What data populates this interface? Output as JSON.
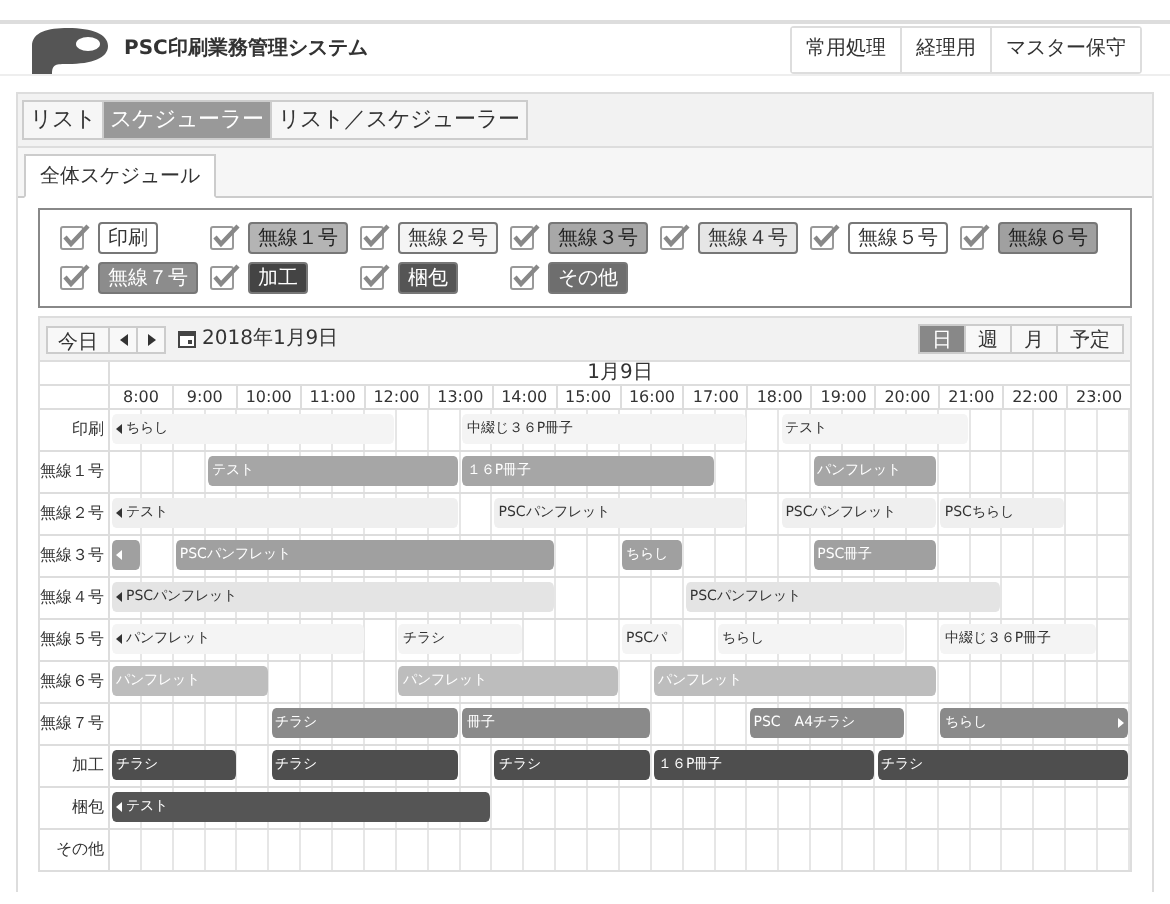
{
  "header": {
    "title": "PSC印刷業務管理システム",
    "menu": [
      "常用処理",
      "経理用",
      "マスター保守"
    ]
  },
  "view_tabs": [
    {
      "label": "リスト",
      "selected": false
    },
    {
      "label": "スケジューラー",
      "selected": true
    },
    {
      "label": "リスト／スケジューラー",
      "selected": false
    }
  ],
  "sub_tabs": [
    {
      "label": "全体スケジュール",
      "selected": true
    }
  ],
  "filters": [
    {
      "label": "印刷",
      "checked": true,
      "color": "#ffffff"
    },
    {
      "label": "無線１号",
      "checked": true,
      "color": "#b4b4b4"
    },
    {
      "label": "無線２号",
      "checked": true,
      "color": "#f4f4f4"
    },
    {
      "label": "無線３号",
      "checked": true,
      "color": "#a8a8a8"
    },
    {
      "label": "無線４号",
      "checked": true,
      "color": "#e6e6e6"
    },
    {
      "label": "無線５号",
      "checked": true,
      "color": "#ffffff"
    },
    {
      "label": "無線６号",
      "checked": true,
      "color": "#a0a0a0"
    },
    {
      "label": "無線７号",
      "checked": true,
      "color": "#8c8c8c"
    },
    {
      "label": "加工",
      "checked": true,
      "color": "#444444"
    },
    {
      "label": "梱包",
      "checked": true,
      "color": "#555555"
    },
    {
      "label": "その他",
      "checked": true,
      "color": "#6e6e6e"
    }
  ],
  "toolbar": {
    "today": "今日",
    "date": "2018年1月9日",
    "views": [
      {
        "label": "日",
        "selected": true
      },
      {
        "label": "週",
        "selected": false
      },
      {
        "label": "月",
        "selected": false
      },
      {
        "label": "予定",
        "selected": false
      }
    ]
  },
  "schedule": {
    "day": "1月9日",
    "hours": [
      "8:00",
      "9:00",
      "10:00",
      "11:00",
      "12:00",
      "13:00",
      "14:00",
      "15:00",
      "16:00",
      "17:00",
      "18:00",
      "19:00",
      "20:00",
      "21:00",
      "22:00",
      "23:00"
    ],
    "rows": [
      {
        "label": "印刷",
        "cells": [
          {
            "kind": "start",
            "label": "ちらし",
            "color": "#f4f4f4",
            "continues_before": true,
            "continues_after": false
          },
          {
            "kind": "cont"
          },
          {
            "kind": "cont"
          },
          {
            "kind": "cont"
          },
          {
            "kind": "cont"
          },
          {
            "kind": "cont"
          },
          {
            "kind": "cont"
          },
          {
            "kind": "cont"
          },
          {
            "kind": "cont"
          },
          {
            "kind": "free"
          },
          {
            "kind": "free"
          },
          {
            "kind": "start",
            "label": "中綴じ３６P冊子",
            "color": "#f4f4f4",
            "continues_before": false,
            "continues_after": false
          },
          {
            "kind": "cont"
          },
          {
            "kind": "cont"
          },
          {
            "kind": "cont"
          },
          {
            "kind": "cont"
          },
          {
            "kind": "cont"
          },
          {
            "kind": "cont"
          },
          {
            "kind": "cont"
          },
          {
            "kind": "cont"
          },
          {
            "kind": "free"
          },
          {
            "kind": "start",
            "label": "テスト",
            "color": "#f4f4f4",
            "continues_before": false,
            "continues_after": false
          },
          {
            "kind": "cont"
          },
          {
            "kind": "cont"
          },
          {
            "kind": "cont"
          },
          {
            "kind": "cont"
          },
          {
            "kind": "cont"
          }
        ]
      },
      {
        "label": "無線１号",
        "cells": [
          {
            "kind": "free"
          },
          {
            "kind": "free"
          },
          {
            "kind": "free"
          },
          {
            "kind": "start",
            "label": "テスト",
            "color": "#a6a6a6",
            "continues_before": false,
            "continues_after": false
          },
          {
            "kind": "cont"
          },
          {
            "kind": "cont"
          },
          {
            "kind": "cont"
          },
          {
            "kind": "cont"
          },
          {
            "kind": "cont"
          },
          {
            "kind": "cont"
          },
          {
            "kind": "cont"
          },
          {
            "kind": "start",
            "label": "１６P冊子",
            "color": "#a6a6a6",
            "continues_before": false,
            "continues_after": false
          },
          {
            "kind": "cont"
          },
          {
            "kind": "cont"
          },
          {
            "kind": "cont"
          },
          {
            "kind": "cont"
          },
          {
            "kind": "cont"
          },
          {
            "kind": "cont"
          },
          {
            "kind": "cont"
          },
          {
            "kind": "free"
          },
          {
            "kind": "free"
          },
          {
            "kind": "free"
          },
          {
            "kind": "start",
            "label": "パンフレット",
            "color": "#a6a6a6",
            "continues_before": false,
            "continues_after": false
          },
          {
            "kind": "cont"
          },
          {
            "kind": "cont"
          },
          {
            "kind": "cont"
          }
        ]
      },
      {
        "label": "無線２号",
        "cells": [
          {
            "kind": "start",
            "label": "テスト",
            "color": "#efefef",
            "continues_before": true,
            "continues_after": false
          },
          {
            "kind": "cont"
          },
          {
            "kind": "cont"
          },
          {
            "kind": "cont"
          },
          {
            "kind": "cont"
          },
          {
            "kind": "cont"
          },
          {
            "kind": "cont"
          },
          {
            "kind": "cont"
          },
          {
            "kind": "cont"
          },
          {
            "kind": "cont"
          },
          {
            "kind": "cont"
          },
          {
            "kind": "free"
          },
          {
            "kind": "start",
            "label": "PSCパンフレット",
            "color": "#efefef",
            "continues_before": false,
            "continues_after": false
          },
          {
            "kind": "cont"
          },
          {
            "kind": "cont"
          },
          {
            "kind": "cont"
          },
          {
            "kind": "cont"
          },
          {
            "kind": "cont"
          },
          {
            "kind": "cont"
          },
          {
            "kind": "cont"
          },
          {
            "kind": "free"
          },
          {
            "kind": "start",
            "label": "PSCパンフレット",
            "color": "#efefef",
            "continues_before": false,
            "continues_after": false
          },
          {
            "kind": "cont"
          },
          {
            "kind": "cont"
          },
          {
            "kind": "cont"
          },
          {
            "kind": "cont"
          },
          {
            "kind": "start",
            "label": "PSCちらし",
            "color": "#efefef",
            "continues_before": false,
            "continues_after": false
          },
          {
            "kind": "cont"
          },
          {
            "kind": "cont"
          },
          {
            "kind": "cont"
          }
        ]
      },
      {
        "label": "無線３号",
        "cells": [
          {
            "kind": "start",
            "color": "#a0a0a0",
            "continues_before": true,
            "continues_after": false
          },
          {
            "kind": "free"
          },
          {
            "kind": "start",
            "label": "PSCパンフレット",
            "color": "#a0a0a0",
            "continues_before": false,
            "continues_after": false
          },
          {
            "kind": "cont"
          },
          {
            "kind": "cont"
          },
          {
            "kind": "cont"
          },
          {
            "kind": "cont"
          },
          {
            "kind": "cont"
          },
          {
            "kind": "cont"
          },
          {
            "kind": "cont"
          },
          {
            "kind": "cont"
          },
          {
            "kind": "cont"
          },
          {
            "kind": "cont"
          },
          {
            "kind": "cont"
          },
          {
            "kind": "free"
          },
          {
            "kind": "free"
          },
          {
            "kind": "start",
            "label": "ちらし",
            "color": "#a0a0a0",
            "continues_before": false,
            "continues_after": false
          },
          {
            "kind": "cont"
          },
          {
            "kind": "free"
          },
          {
            "kind": "free"
          },
          {
            "kind": "free"
          },
          {
            "kind": "free"
          },
          {
            "kind": "start",
            "label": "PSC冊子",
            "color": "#a0a0a0",
            "continues_before": false,
            "continues_after": false
          },
          {
            "kind": "cont"
          },
          {
            "kind": "cont"
          },
          {
            "kind": "cont"
          }
        ]
      },
      {
        "label": "無線４号",
        "cells": [
          {
            "kind": "start",
            "label": "PSCパンフレット",
            "color": "#e4e4e4",
            "continues_before": true,
            "continues_after": false
          },
          {
            "kind": "cont"
          },
          {
            "kind": "cont"
          },
          {
            "kind": "cont"
          },
          {
            "kind": "cont"
          },
          {
            "kind": "cont"
          },
          {
            "kind": "cont"
          },
          {
            "kind": "cont"
          },
          {
            "kind": "cont"
          },
          {
            "kind": "cont"
          },
          {
            "kind": "cont"
          },
          {
            "kind": "cont"
          },
          {
            "kind": "cont"
          },
          {
            "kind": "cont"
          },
          {
            "kind": "free"
          },
          {
            "kind": "free"
          },
          {
            "kind": "free"
          },
          {
            "kind": "free"
          },
          {
            "kind": "start",
            "label": "PSCパンフレット",
            "color": "#e4e4e4",
            "continues_before": false,
            "continues_after": false
          },
          {
            "kind": "cont"
          },
          {
            "kind": "cont"
          },
          {
            "kind": "cont"
          },
          {
            "kind": "cont"
          },
          {
            "kind": "cont"
          },
          {
            "kind": "cont"
          },
          {
            "kind": "cont"
          },
          {
            "kind": "cont"
          },
          {
            "kind": "cont"
          }
        ]
      },
      {
        "label": "無線５号",
        "cells": [
          {
            "kind": "start",
            "label": "パンフレット",
            "color": "#f4f4f4",
            "continues_before": true,
            "continues_after": false
          },
          {
            "kind": "cont"
          },
          {
            "kind": "cont"
          },
          {
            "kind": "cont"
          },
          {
            "kind": "cont"
          },
          {
            "kind": "cont"
          },
          {
            "kind": "cont"
          },
          {
            "kind": "cont"
          },
          {
            "kind": "free"
          },
          {
            "kind": "start",
            "label": "チラシ",
            "color": "#f4f4f4",
            "continues_before": false,
            "continues_after": false
          },
          {
            "kind": "cont"
          },
          {
            "kind": "cont"
          },
          {
            "kind": "cont"
          },
          {
            "kind": "free"
          },
          {
            "kind": "free"
          },
          {
            "kind": "free"
          },
          {
            "kind": "start",
            "label": "PSCパ",
            "color": "#f4f4f4",
            "continues_before": false,
            "continues_after": false
          },
          {
            "kind": "cont"
          },
          {
            "kind": "free"
          },
          {
            "kind": "start",
            "label": "ちらし",
            "color": "#f4f4f4",
            "continues_before": false,
            "continues_after": false
          },
          {
            "kind": "cont"
          },
          {
            "kind": "cont"
          },
          {
            "kind": "cont"
          },
          {
            "kind": "cont"
          },
          {
            "kind": "cont"
          },
          {
            "kind": "free"
          },
          {
            "kind": "start",
            "label": "中綴じ３６P冊子",
            "color": "#f4f4f4",
            "continues_before": false,
            "continues_after": false
          },
          {
            "kind": "cont"
          },
          {
            "kind": "cont"
          },
          {
            "kind": "cont"
          },
          {
            "kind": "cont"
          }
        ]
      },
      {
        "label": "無線６号",
        "cells": [
          {
            "kind": "start",
            "label": "パンフレット",
            "color": "#bdbdbd",
            "continues_before": false,
            "continues_after": false
          },
          {
            "kind": "cont"
          },
          {
            "kind": "cont"
          },
          {
            "kind": "cont"
          },
          {
            "kind": "cont"
          },
          {
            "kind": "free"
          },
          {
            "kind": "free"
          },
          {
            "kind": "free"
          },
          {
            "kind": "free"
          },
          {
            "kind": "start",
            "label": "パンフレット",
            "color": "#bdbdbd",
            "continues_before": false,
            "continues_after": false
          },
          {
            "kind": "cont"
          },
          {
            "kind": "cont"
          },
          {
            "kind": "cont"
          },
          {
            "kind": "cont"
          },
          {
            "kind": "cont"
          },
          {
            "kind": "cont"
          },
          {
            "kind": "free"
          },
          {
            "kind": "start",
            "label": "パンフレット",
            "color": "#bdbdbd",
            "continues_before": false,
            "continues_after": false
          },
          {
            "kind": "cont"
          },
          {
            "kind": "cont"
          },
          {
            "kind": "cont"
          },
          {
            "kind": "cont"
          },
          {
            "kind": "cont"
          },
          {
            "kind": "cont"
          },
          {
            "kind": "cont"
          },
          {
            "kind": "cont"
          }
        ]
      },
      {
        "label": "無線７号",
        "cells": [
          {
            "kind": "free"
          },
          {
            "kind": "free"
          },
          {
            "kind": "free"
          },
          {
            "kind": "free"
          },
          {
            "kind": "free"
          },
          {
            "kind": "start",
            "label": "チラシ",
            "color": "#8a8a8a",
            "continues_before": false,
            "continues_after": false
          },
          {
            "kind": "cont"
          },
          {
            "kind": "cont"
          },
          {
            "kind": "cont"
          },
          {
            "kind": "cont"
          },
          {
            "kind": "cont"
          },
          {
            "kind": "start",
            "label": "冊子",
            "color": "#8a8a8a",
            "continues_before": false,
            "continues_after": false
          },
          {
            "kind": "cont"
          },
          {
            "kind": "cont"
          },
          {
            "kind": "cont"
          },
          {
            "kind": "cont"
          },
          {
            "kind": "cont"
          },
          {
            "kind": "free"
          },
          {
            "kind": "free"
          },
          {
            "kind": "free"
          },
          {
            "kind": "start",
            "label": "PSC　A4チラシ",
            "color": "#8a8a8a",
            "continues_before": false,
            "continues_after": false
          },
          {
            "kind": "cont"
          },
          {
            "kind": "cont"
          },
          {
            "kind": "cont"
          },
          {
            "kind": "cont"
          },
          {
            "kind": "free"
          },
          {
            "kind": "start",
            "label": "ちらし",
            "color": "#8a8a8a",
            "continues_before": false,
            "continues_after": true
          },
          {
            "kind": "cont"
          },
          {
            "kind": "cont"
          },
          {
            "kind": "cont"
          },
          {
            "kind": "cont"
          },
          {
            "kind": "cont"
          }
        ]
      },
      {
        "label": "加工",
        "cells": [
          {
            "kind": "start",
            "label": "チラシ",
            "color": "#4e4e4e",
            "continues_before": false,
            "continues_after": false
          },
          {
            "kind": "cont"
          },
          {
            "kind": "cont"
          },
          {
            "kind": "cont"
          },
          {
            "kind": "free"
          },
          {
            "kind": "start",
            "label": "チラシ",
            "color": "#4e4e4e",
            "continues_before": false,
            "continues_after": false
          },
          {
            "kind": "cont"
          },
          {
            "kind": "cont"
          },
          {
            "kind": "cont"
          },
          {
            "kind": "cont"
          },
          {
            "kind": "cont"
          },
          {
            "kind": "free"
          },
          {
            "kind": "start",
            "label": "チラシ",
            "color": "#4e4e4e",
            "continues_before": false,
            "continues_after": false
          },
          {
            "kind": "cont"
          },
          {
            "kind": "cont"
          },
          {
            "kind": "cont"
          },
          {
            "kind": "cont"
          },
          {
            "kind": "start",
            "label": "１６P冊子",
            "color": "#4e4e4e",
            "continues_before": false,
            "continues_after": false
          },
          {
            "kind": "cont"
          },
          {
            "kind": "cont"
          },
          {
            "kind": "cont"
          },
          {
            "kind": "cont"
          },
          {
            "kind": "cont"
          },
          {
            "kind": "cont"
          },
          {
            "kind": "start",
            "label": "チラシ",
            "color": "#4e4e4e",
            "continues_before": false,
            "continues_after": false
          },
          {
            "kind": "cont"
          },
          {
            "kind": "cont"
          },
          {
            "kind": "cont"
          },
          {
            "kind": "cont"
          },
          {
            "kind": "cont"
          },
          {
            "kind": "cont"
          },
          {
            "kind": "cont"
          }
        ]
      },
      {
        "label": "梱包",
        "cells": [
          {
            "kind": "start",
            "label": "テスト",
            "color": "#555555",
            "continues_before": true,
            "continues_after": false
          },
          {
            "kind": "cont"
          },
          {
            "kind": "cont"
          },
          {
            "kind": "cont"
          },
          {
            "kind": "cont"
          },
          {
            "kind": "cont"
          },
          {
            "kind": "cont"
          },
          {
            "kind": "cont"
          },
          {
            "kind": "cont"
          },
          {
            "kind": "cont"
          },
          {
            "kind": "cont"
          },
          {
            "kind": "cont"
          }
        ]
      },
      {
        "label": "その他"
      }
    ]
  }
}
